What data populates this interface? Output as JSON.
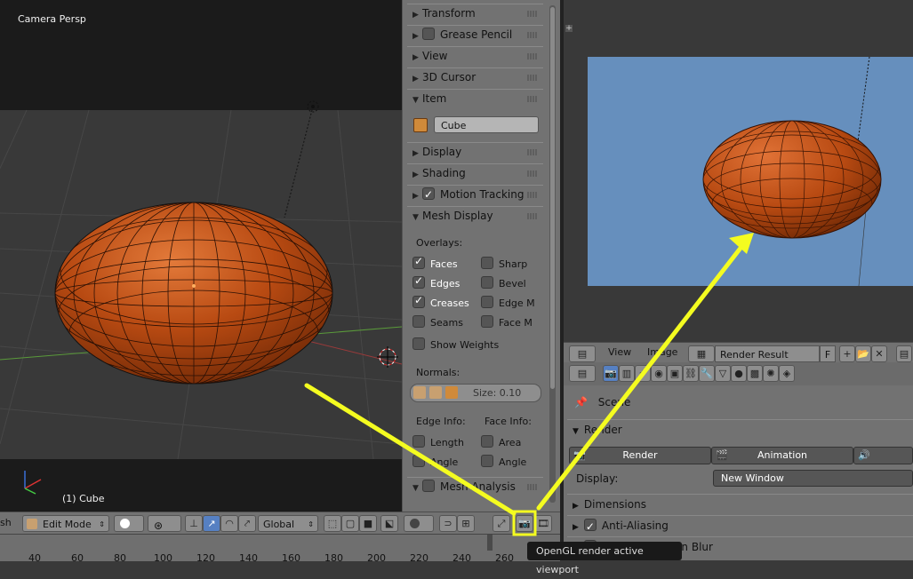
{
  "viewport": {
    "mode_label": "Camera Persp",
    "object_label": "(1) Cube"
  },
  "npanel": {
    "sections": {
      "transform": "Transform",
      "grease_pencil": "Grease Pencil",
      "view": "View",
      "cursor": "3D Cursor",
      "item": "Item",
      "display": "Display",
      "shading": "Shading",
      "motion_tracking": "Motion Tracking",
      "mesh_display": "Mesh Display",
      "mesh_analysis": "Mesh Analysis"
    },
    "item_name": "Cube",
    "overlays_label": "Overlays:",
    "overlays": {
      "faces": "Faces",
      "sharp": "Sharp",
      "edges": "Edges",
      "bevel": "Bevel",
      "creases": "Creases",
      "edge_m": "Edge M",
      "seams": "Seams",
      "face_m": "Face M",
      "show_weights": "Show Weights"
    },
    "normals_label": "Normals:",
    "normals_size": "Size:  0.10",
    "edge_info_label": "Edge Info:",
    "face_info_label": "Face Info:",
    "edge_length": "Length",
    "edge_angle": "Angle",
    "face_area": "Area",
    "face_angle": "Angle"
  },
  "header": {
    "partial_label": "sh",
    "mode": "Edit Mode",
    "orientation": "Global"
  },
  "timeline": {
    "ticks": [
      "40",
      "60",
      "80",
      "100",
      "120",
      "140",
      "160",
      "180",
      "200",
      "220",
      "240",
      "260"
    ]
  },
  "image_editor": {
    "menu_view": "View",
    "menu_image": "Image",
    "image_name": "Render Result",
    "fake_user": "F"
  },
  "properties": {
    "scene_label": "Scene",
    "render_section": "Render",
    "render_button": "Render",
    "animation_button": "Animation",
    "display_label": "Display:",
    "display_value": "New Window",
    "dimensions_section": "Dimensions",
    "anti_aliasing_section": "Anti-Aliasing",
    "motion_blur_section": "Sampled Motion Blur"
  },
  "tooltip": "OpenGL render active viewport",
  "colors": {
    "annotation": "#f4fc20",
    "mesh": "#b84a12",
    "render_bg": "#668fbd"
  }
}
